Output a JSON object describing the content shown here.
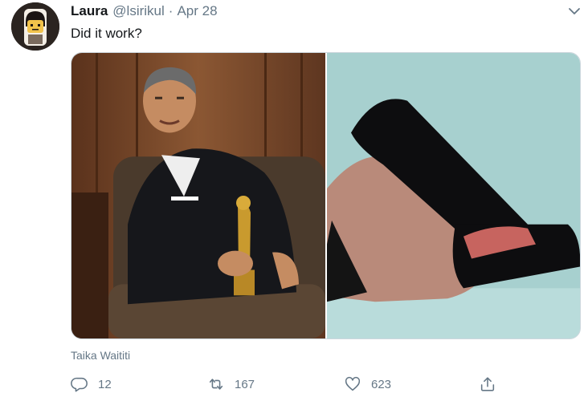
{
  "tweet": {
    "author_name": "Laura",
    "author_handle": "@lsirikul",
    "separator": "·",
    "date": "Apr 28",
    "text": "Did it work?",
    "media_credit": "Taika Waititi",
    "icons": {
      "avatar": "cartoon-avatar",
      "menu": "chevron-down-icon",
      "reply": "reply-icon",
      "retweet": "retweet-icon",
      "like": "heart-icon",
      "share": "share-icon"
    },
    "actions": {
      "reply_count": "12",
      "retweet_count": "167",
      "like_count": "623"
    },
    "colors": {
      "text": "#14171a",
      "secondary": "#657786",
      "border": "#ccd6dd"
    }
  }
}
